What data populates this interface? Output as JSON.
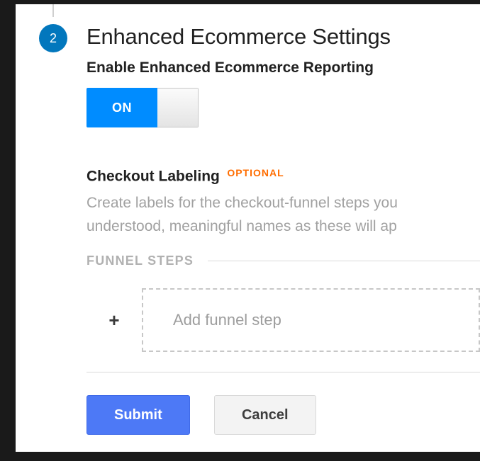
{
  "step": {
    "number": "2",
    "title": "Enhanced Ecommerce Settings"
  },
  "enable": {
    "heading": "Enable Enhanced Ecommerce Reporting",
    "toggle_state": "ON"
  },
  "checkout": {
    "heading": "Checkout Labeling",
    "badge": "OPTIONAL",
    "description_line1": "Create labels for the checkout-funnel steps you",
    "description_line2": "understood, meaningful names as these will ap",
    "funnel_label": "FUNNEL STEPS",
    "add_placeholder": "Add funnel step"
  },
  "buttons": {
    "submit": "Submit",
    "cancel": "Cancel"
  }
}
